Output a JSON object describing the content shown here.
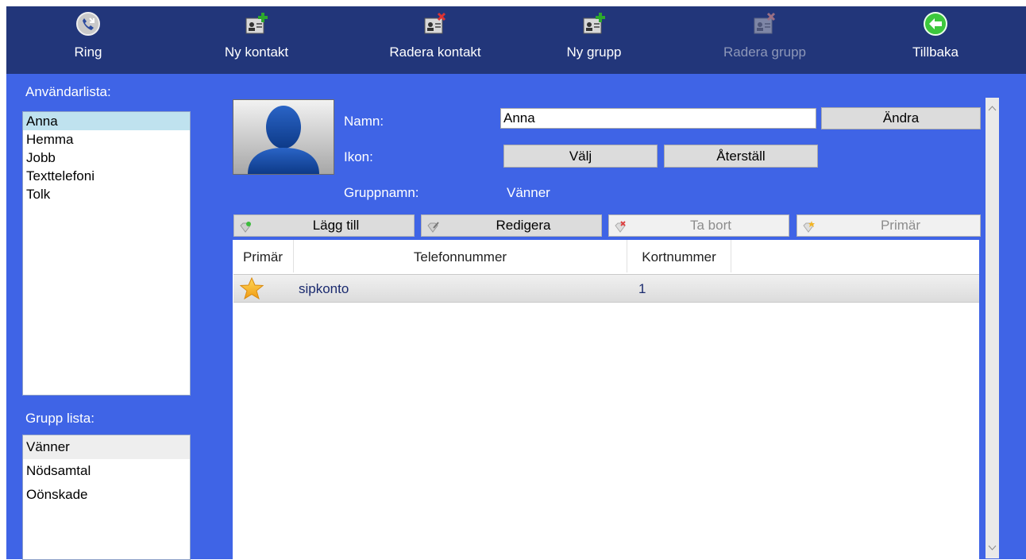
{
  "toolbar": {
    "ring": "Ring",
    "new_contact": "Ny kontakt",
    "delete_contact": "Radera kontakt",
    "new_group": "Ny grupp",
    "delete_group": "Radera grupp",
    "back": "Tillbaka"
  },
  "sidebar": {
    "users_label": "Användarlista:",
    "users": [
      "Anna",
      "Hemma",
      "Jobb",
      "Texttelefoni",
      "Tolk"
    ],
    "groups_label": "Grupp lista:",
    "groups": [
      "Vänner",
      "Nödsamtal",
      "Oönskade"
    ]
  },
  "contact": {
    "name_label": "Namn:",
    "name_value": "Anna",
    "change_button": "Ändra",
    "icon_label": "Ikon:",
    "choose_button": "Välj",
    "reset_button": "Återställ",
    "group_label": "Gruppnamn:",
    "group_value": "Vänner"
  },
  "actions": {
    "add": "Lägg till",
    "edit": "Redigera",
    "remove": "Ta bort",
    "primary": "Primär"
  },
  "table": {
    "headers": [
      "Primär",
      "Telefonnummer",
      "Kortnummer"
    ],
    "rows": [
      {
        "number": "sipkonto",
        "short": "1"
      }
    ]
  },
  "colors": {
    "toolbar_bg": "#22367a",
    "panel_bg": "#3f64e6",
    "selection": "#bfe2ef"
  }
}
